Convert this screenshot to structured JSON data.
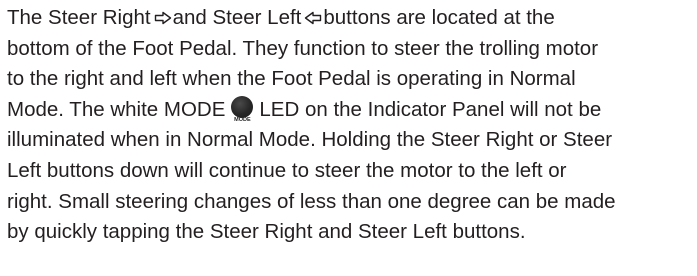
{
  "paragraph": {
    "line1": {
      "a": "The Steer Right",
      "b": "and Steer Left",
      "c": "buttons are located at the"
    },
    "line2": "bottom of the Foot Pedal. They function to steer the trolling motor",
    "line3": "to the right and left when the Foot Pedal is operating in Normal",
    "line4": {
      "a": "Mode. The white MODE",
      "b": "LED on the Indicator Panel will not be"
    },
    "line5": "illuminated when in Normal Mode. Holding the Steer Right or Steer",
    "line6": "Left buttons down will continue to steer the motor to the left or",
    "line7": "right. Small steering changes of less than one degree can be made",
    "line8": "by quickly tapping the Steer Right and Steer Left buttons."
  },
  "icons": {
    "steer_right": "arrow-right-outline-icon",
    "steer_left": "arrow-left-outline-icon",
    "mode_led": "mode-led-icon",
    "mode_led_caption": "MODE"
  },
  "colors": {
    "text": "#231f20",
    "led": "#262626"
  }
}
